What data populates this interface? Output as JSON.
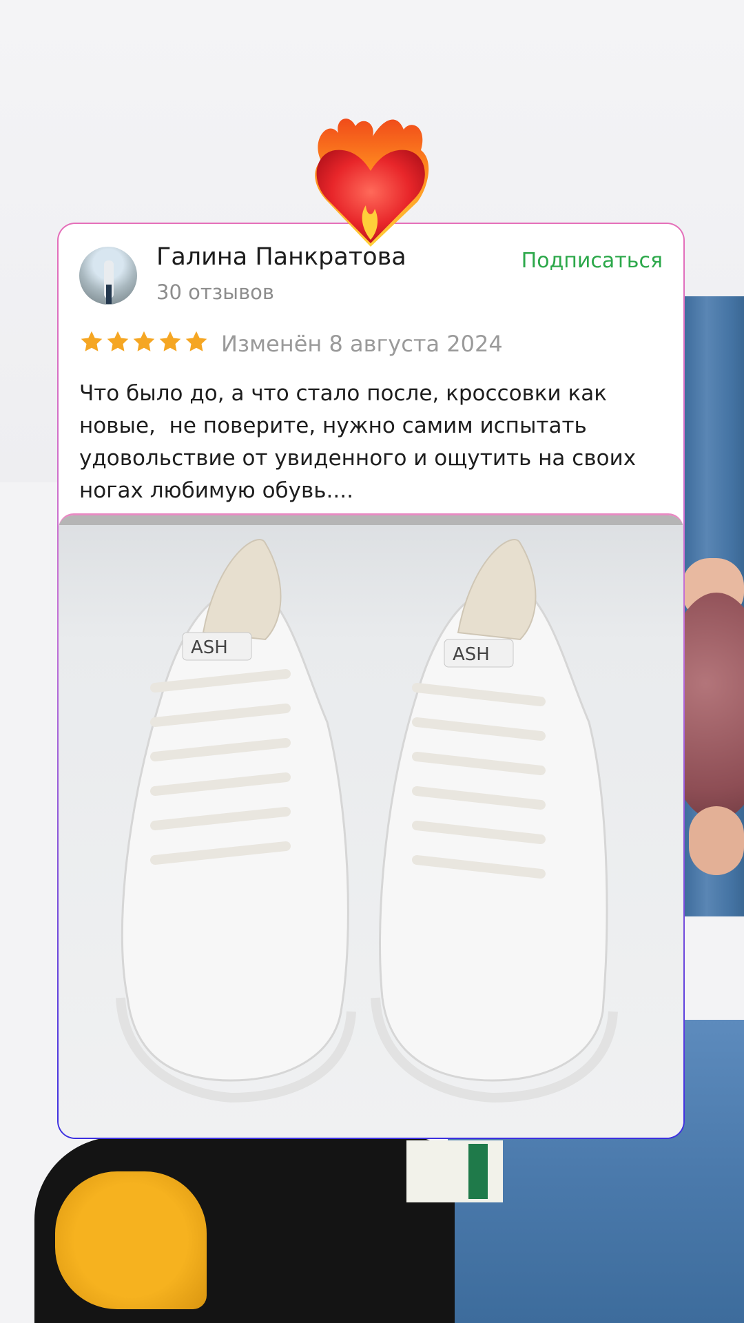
{
  "review": {
    "author": "Галина Панкратова",
    "reviews_count": "30 отзывов",
    "subscribe_label": "Подписаться",
    "rating": 5,
    "edited": "Изменён 8 августа 2024",
    "text": "Что было до, а что стало после, кроссовки как\nновые,  не поверите, нужно самим испытать\nудовольствие от увиденного и ощутить на своих\nногах любимую обувь...."
  },
  "photo": {
    "brand_left": "ASH",
    "brand_right": "ASH"
  },
  "colors": {
    "subscribe": "#2ca84a",
    "star": "#f5a623",
    "card_border_top": "#e56fb9",
    "card_border_bottom": "#3b2fe0"
  },
  "icons": [
    "fire-heart-icon",
    "star-icon"
  ]
}
